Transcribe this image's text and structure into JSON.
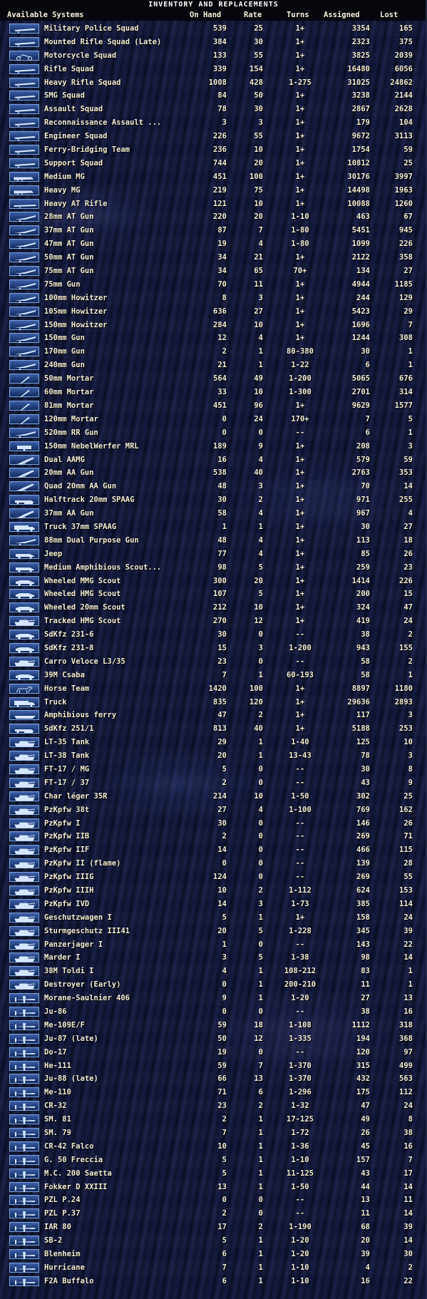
{
  "window": {
    "title": "INVENTORY AND REPLACEMENTS"
  },
  "header": {
    "systems": "Available Systems",
    "on_hand": "On Hand",
    "rate": "Rate",
    "turns": "Turns",
    "assigned": "Assigned",
    "lost": "Lost"
  },
  "colors": {
    "text": "#f3ecd4",
    "icon_fill": "#2b4a90",
    "icon_border": "#7ea2df",
    "background": "#0d1128"
  },
  "rows": [
    {
      "icon": "infantry-icon",
      "name": "Military Police Squad",
      "on_hand": "539",
      "rate": "25",
      "turns": "1+",
      "assigned": "3354",
      "lost": "165"
    },
    {
      "icon": "infantry-icon",
      "name": "Mounted Rifle Squad (Late)",
      "on_hand": "384",
      "rate": "30",
      "turns": "1+",
      "assigned": "2323",
      "lost": "375"
    },
    {
      "icon": "motorcycle-icon",
      "name": "Motorcycle Squad",
      "on_hand": "133",
      "rate": "55",
      "turns": "1+",
      "assigned": "3825",
      "lost": "2039"
    },
    {
      "icon": "infantry-icon",
      "name": "Rifle Squad",
      "on_hand": "339",
      "rate": "154",
      "turns": "1+",
      "assigned": "16480",
      "lost": "6056"
    },
    {
      "icon": "infantry-icon",
      "name": "Heavy Rifle Squad",
      "on_hand": "1008",
      "rate": "428",
      "turns": "1-275",
      "assigned": "31025",
      "lost": "24862"
    },
    {
      "icon": "infantry-icon",
      "name": "SMG Squad",
      "on_hand": "84",
      "rate": "50",
      "turns": "1+",
      "assigned": "3238",
      "lost": "2144"
    },
    {
      "icon": "infantry-icon",
      "name": "Assault Squad",
      "on_hand": "78",
      "rate": "30",
      "turns": "1+",
      "assigned": "2867",
      "lost": "2628"
    },
    {
      "icon": "infantry-icon",
      "name": "Reconnaissance Assault ...",
      "on_hand": "3",
      "rate": "3",
      "turns": "1+",
      "assigned": "179",
      "lost": "104"
    },
    {
      "icon": "infantry-icon",
      "name": "Engineer Squad",
      "on_hand": "226",
      "rate": "55",
      "turns": "1+",
      "assigned": "9672",
      "lost": "3113"
    },
    {
      "icon": "infantry-icon",
      "name": "Ferry-Bridging Team",
      "on_hand": "236",
      "rate": "10",
      "turns": "1+",
      "assigned": "1754",
      "lost": "59"
    },
    {
      "icon": "infantry-icon",
      "name": "Support Squad",
      "on_hand": "744",
      "rate": "20",
      "turns": "1+",
      "assigned": "10812",
      "lost": "25"
    },
    {
      "icon": "machinegun-icon",
      "name": "Medium MG",
      "on_hand": "451",
      "rate": "100",
      "turns": "1+",
      "assigned": "30176",
      "lost": "3997"
    },
    {
      "icon": "machinegun-icon",
      "name": "Heavy MG",
      "on_hand": "219",
      "rate": "75",
      "turns": "1+",
      "assigned": "14498",
      "lost": "1963"
    },
    {
      "icon": "rifle-icon",
      "name": "Heavy AT Rifle",
      "on_hand": "121",
      "rate": "10",
      "turns": "1+",
      "assigned": "10088",
      "lost": "1260"
    },
    {
      "icon": "gun-icon",
      "name": "28mm AT Gun",
      "on_hand": "220",
      "rate": "20",
      "turns": "1-10",
      "assigned": "463",
      "lost": "67"
    },
    {
      "icon": "gun-icon",
      "name": "37mm AT Gun",
      "on_hand": "87",
      "rate": "7",
      "turns": "1-80",
      "assigned": "5451",
      "lost": "945"
    },
    {
      "icon": "gun-icon",
      "name": "47mm AT Gun",
      "on_hand": "19",
      "rate": "4",
      "turns": "1-80",
      "assigned": "1099",
      "lost": "226"
    },
    {
      "icon": "gun-icon",
      "name": "50mm AT Gun",
      "on_hand": "34",
      "rate": "21",
      "turns": "1+",
      "assigned": "2122",
      "lost": "358"
    },
    {
      "icon": "gun-icon",
      "name": "75mm AT Gun",
      "on_hand": "34",
      "rate": "65",
      "turns": "70+",
      "assigned": "134",
      "lost": "27"
    },
    {
      "icon": "gun-icon",
      "name": "75mm Gun",
      "on_hand": "70",
      "rate": "11",
      "turns": "1+",
      "assigned": "4944",
      "lost": "1185"
    },
    {
      "icon": "gun-icon",
      "name": "100mm Howitzer",
      "on_hand": "8",
      "rate": "3",
      "turns": "1+",
      "assigned": "244",
      "lost": "129"
    },
    {
      "icon": "gun-icon",
      "name": "105mm Howitzer",
      "on_hand": "636",
      "rate": "27",
      "turns": "1+",
      "assigned": "5423",
      "lost": "29"
    },
    {
      "icon": "gun-icon",
      "name": "150mm Howitzer",
      "on_hand": "284",
      "rate": "10",
      "turns": "1+",
      "assigned": "1696",
      "lost": "7"
    },
    {
      "icon": "gun-icon",
      "name": "150mm Gun",
      "on_hand": "12",
      "rate": "4",
      "turns": "1+",
      "assigned": "1244",
      "lost": "308"
    },
    {
      "icon": "gun-icon",
      "name": "170mm Gun",
      "on_hand": "2",
      "rate": "1",
      "turns": "80-380",
      "assigned": "30",
      "lost": "1"
    },
    {
      "icon": "gun-icon",
      "name": "240mm Gun",
      "on_hand": "21",
      "rate": "1",
      "turns": "1-22",
      "assigned": "6",
      "lost": "1"
    },
    {
      "icon": "mortar-icon",
      "name": "50mm Mortar",
      "on_hand": "564",
      "rate": "49",
      "turns": "1-200",
      "assigned": "5065",
      "lost": "676"
    },
    {
      "icon": "mortar-icon",
      "name": "60mm Mortar",
      "on_hand": "33",
      "rate": "10",
      "turns": "1-300",
      "assigned": "2701",
      "lost": "314"
    },
    {
      "icon": "mortar-icon",
      "name": "81mm Mortar",
      "on_hand": "451",
      "rate": "96",
      "turns": "1+",
      "assigned": "9629",
      "lost": "1577"
    },
    {
      "icon": "mortar-icon",
      "name": "120mm Mortar",
      "on_hand": "0",
      "rate": "24",
      "turns": "170+",
      "assigned": "7",
      "lost": "5"
    },
    {
      "icon": "gun-icon",
      "name": "520mm RR Gun",
      "on_hand": "0",
      "rate": "0",
      "turns": "--",
      "assigned": "6",
      "lost": "1"
    },
    {
      "icon": "rocket-icon",
      "name": "150mm NebelWerfer MRL",
      "on_hand": "189",
      "rate": "9",
      "turns": "1+",
      "assigned": "208",
      "lost": "3"
    },
    {
      "icon": "aa-gun-icon",
      "name": "Dual AAMG",
      "on_hand": "16",
      "rate": "4",
      "turns": "1+",
      "assigned": "579",
      "lost": "59"
    },
    {
      "icon": "aa-gun-icon",
      "name": "20mm AA Gun",
      "on_hand": "538",
      "rate": "40",
      "turns": "1+",
      "assigned": "2763",
      "lost": "353"
    },
    {
      "icon": "aa-gun-icon",
      "name": "Quad 20mm AA Gun",
      "on_hand": "48",
      "rate": "3",
      "turns": "1+",
      "assigned": "70",
      "lost": "14"
    },
    {
      "icon": "halftrack-icon",
      "name": "Halftrack 20mm SPAAG",
      "on_hand": "30",
      "rate": "2",
      "turns": "1+",
      "assigned": "971",
      "lost": "255"
    },
    {
      "icon": "aa-gun-icon",
      "name": "37mm AA Gun",
      "on_hand": "58",
      "rate": "4",
      "turns": "1+",
      "assigned": "967",
      "lost": "4"
    },
    {
      "icon": "truck-icon",
      "name": "Truck 37mm SPAAG",
      "on_hand": "1",
      "rate": "1",
      "turns": "1+",
      "assigned": "30",
      "lost": "27"
    },
    {
      "icon": "gun-icon",
      "name": "88mm Dual Purpose Gun",
      "on_hand": "48",
      "rate": "4",
      "turns": "1+",
      "assigned": "113",
      "lost": "18"
    },
    {
      "icon": "car-icon",
      "name": "Jeep",
      "on_hand": "77",
      "rate": "4",
      "turns": "1+",
      "assigned": "85",
      "lost": "26"
    },
    {
      "icon": "car-icon",
      "name": "Medium Amphibious Scout...",
      "on_hand": "98",
      "rate": "5",
      "turns": "1+",
      "assigned": "259",
      "lost": "23"
    },
    {
      "icon": "armored-car-icon",
      "name": "Wheeled MMG Scout",
      "on_hand": "300",
      "rate": "20",
      "turns": "1+",
      "assigned": "1414",
      "lost": "226"
    },
    {
      "icon": "armored-car-icon",
      "name": "Wheeled HMG Scout",
      "on_hand": "107",
      "rate": "5",
      "turns": "1+",
      "assigned": "200",
      "lost": "15"
    },
    {
      "icon": "armored-car-icon",
      "name": "Wheeled 20mm Scout",
      "on_hand": "212",
      "rate": "10",
      "turns": "1+",
      "assigned": "324",
      "lost": "47"
    },
    {
      "icon": "tank-icon",
      "name": "Tracked HMG Scout",
      "on_hand": "270",
      "rate": "12",
      "turns": "1+",
      "assigned": "419",
      "lost": "24"
    },
    {
      "icon": "armored-car-icon",
      "name": "SdKfz 231-6",
      "on_hand": "30",
      "rate": "0",
      "turns": "--",
      "assigned": "38",
      "lost": "2"
    },
    {
      "icon": "armored-car-icon",
      "name": "SdKfz 231-8",
      "on_hand": "15",
      "rate": "3",
      "turns": "1-200",
      "assigned": "943",
      "lost": "155"
    },
    {
      "icon": "tank-icon",
      "name": "Carro Veloce L3/35",
      "on_hand": "23",
      "rate": "0",
      "turns": "--",
      "assigned": "58",
      "lost": "2"
    },
    {
      "icon": "armored-car-icon",
      "name": "39M Csaba",
      "on_hand": "7",
      "rate": "1",
      "turns": "60-193",
      "assigned": "58",
      "lost": "1"
    },
    {
      "icon": "horse-icon",
      "name": "Horse Team",
      "on_hand": "1420",
      "rate": "100",
      "turns": "1+",
      "assigned": "8897",
      "lost": "1180"
    },
    {
      "icon": "truck-icon",
      "name": "Truck",
      "on_hand": "835",
      "rate": "120",
      "turns": "1+",
      "assigned": "29636",
      "lost": "2893"
    },
    {
      "icon": "boat-icon",
      "name": "Amphibious ferry",
      "on_hand": "47",
      "rate": "2",
      "turns": "1+",
      "assigned": "117",
      "lost": "3"
    },
    {
      "icon": "halftrack-icon",
      "name": "SdKfz 251/1",
      "on_hand": "813",
      "rate": "40",
      "turns": "1+",
      "assigned": "5188",
      "lost": "253"
    },
    {
      "icon": "tank-icon",
      "name": "LT-35 Tank",
      "on_hand": "29",
      "rate": "1",
      "turns": "1-40",
      "assigned": "125",
      "lost": "10"
    },
    {
      "icon": "tank-icon",
      "name": "LT-38 Tank",
      "on_hand": "20",
      "rate": "1",
      "turns": "13-43",
      "assigned": "78",
      "lost": "3"
    },
    {
      "icon": "tank-icon",
      "name": "FT-17 / MG",
      "on_hand": "5",
      "rate": "0",
      "turns": "--",
      "assigned": "30",
      "lost": "8"
    },
    {
      "icon": "tank-icon",
      "name": "FT-17 / 37",
      "on_hand": "2",
      "rate": "0",
      "turns": "--",
      "assigned": "43",
      "lost": "9"
    },
    {
      "icon": "tank-icon",
      "name": "Char léger 35R",
      "on_hand": "214",
      "rate": "10",
      "turns": "1-50",
      "assigned": "302",
      "lost": "25"
    },
    {
      "icon": "tank-icon",
      "name": "PzKpfw 38t",
      "on_hand": "27",
      "rate": "4",
      "turns": "1-100",
      "assigned": "769",
      "lost": "162"
    },
    {
      "icon": "tank-icon",
      "name": "PzKpfw I",
      "on_hand": "30",
      "rate": "0",
      "turns": "--",
      "assigned": "146",
      "lost": "26"
    },
    {
      "icon": "tank-icon",
      "name": "PzKpfw IIB",
      "on_hand": "2",
      "rate": "0",
      "turns": "--",
      "assigned": "269",
      "lost": "71"
    },
    {
      "icon": "tank-icon",
      "name": "PzKpfw IIF",
      "on_hand": "14",
      "rate": "0",
      "turns": "--",
      "assigned": "466",
      "lost": "115"
    },
    {
      "icon": "tank-icon",
      "name": "PzKpfw II (flame)",
      "on_hand": "0",
      "rate": "0",
      "turns": "--",
      "assigned": "139",
      "lost": "28"
    },
    {
      "icon": "tank-icon",
      "name": "PzKpfw IIIG",
      "on_hand": "124",
      "rate": "0",
      "turns": "--",
      "assigned": "269",
      "lost": "55"
    },
    {
      "icon": "tank-icon",
      "name": "PzKpfw IIIH",
      "on_hand": "10",
      "rate": "2",
      "turns": "1-112",
      "assigned": "624",
      "lost": "153"
    },
    {
      "icon": "tank-icon",
      "name": "PzKpfw IVD",
      "on_hand": "14",
      "rate": "3",
      "turns": "1-73",
      "assigned": "385",
      "lost": "114"
    },
    {
      "icon": "tank-icon",
      "name": "Geschutzwagen I",
      "on_hand": "5",
      "rate": "1",
      "turns": "1+",
      "assigned": "158",
      "lost": "24"
    },
    {
      "icon": "tank-icon",
      "name": "Sturmgeschutz III41",
      "on_hand": "20",
      "rate": "5",
      "turns": "1-228",
      "assigned": "345",
      "lost": "39"
    },
    {
      "icon": "tank-icon",
      "name": "Panzerjager I",
      "on_hand": "1",
      "rate": "0",
      "turns": "--",
      "assigned": "143",
      "lost": "22"
    },
    {
      "icon": "tank-icon",
      "name": "Marder I",
      "on_hand": "3",
      "rate": "5",
      "turns": "1-38",
      "assigned": "98",
      "lost": "14"
    },
    {
      "icon": "tank-icon",
      "name": "38M Toldi I",
      "on_hand": "4",
      "rate": "1",
      "turns": "108-212",
      "assigned": "83",
      "lost": "1"
    },
    {
      "icon": "tank-icon",
      "name": "Destroyer (Early)",
      "on_hand": "0",
      "rate": "1",
      "turns": "200-210",
      "assigned": "11",
      "lost": "1"
    },
    {
      "icon": "aircraft-icon",
      "name": "Morane-Saulnier 406",
      "on_hand": "9",
      "rate": "1",
      "turns": "1-20",
      "assigned": "27",
      "lost": "13"
    },
    {
      "icon": "aircraft-icon",
      "name": "Ju-86",
      "on_hand": "0",
      "rate": "0",
      "turns": "--",
      "assigned": "38",
      "lost": "16"
    },
    {
      "icon": "aircraft-icon",
      "name": "Me-109E/F",
      "on_hand": "59",
      "rate": "18",
      "turns": "1-108",
      "assigned": "1112",
      "lost": "318"
    },
    {
      "icon": "aircraft-icon",
      "name": "Ju-87 (late)",
      "on_hand": "50",
      "rate": "12",
      "turns": "1-335",
      "assigned": "194",
      "lost": "368"
    },
    {
      "icon": "aircraft-icon",
      "name": "Do-17",
      "on_hand": "19",
      "rate": "0",
      "turns": "--",
      "assigned": "120",
      "lost": "97"
    },
    {
      "icon": "aircraft-icon",
      "name": "He-111",
      "on_hand": "59",
      "rate": "7",
      "turns": "1-370",
      "assigned": "315",
      "lost": "499"
    },
    {
      "icon": "aircraft-icon",
      "name": "Ju-88 (late)",
      "on_hand": "66",
      "rate": "13",
      "turns": "1-370",
      "assigned": "432",
      "lost": "563"
    },
    {
      "icon": "aircraft-icon",
      "name": "Me-110",
      "on_hand": "71",
      "rate": "6",
      "turns": "1-296",
      "assigned": "175",
      "lost": "112"
    },
    {
      "icon": "aircraft-icon",
      "name": "CR-32",
      "on_hand": "23",
      "rate": "2",
      "turns": "1-32",
      "assigned": "47",
      "lost": "24"
    },
    {
      "icon": "aircraft-icon",
      "name": "SM. 81",
      "on_hand": "2",
      "rate": "1",
      "turns": "17-125",
      "assigned": "49",
      "lost": "8"
    },
    {
      "icon": "aircraft-icon",
      "name": "SM. 79",
      "on_hand": "7",
      "rate": "1",
      "turns": "1-72",
      "assigned": "26",
      "lost": "38"
    },
    {
      "icon": "aircraft-icon",
      "name": "CR-42 Falco",
      "on_hand": "10",
      "rate": "1",
      "turns": "1-36",
      "assigned": "45",
      "lost": "16"
    },
    {
      "icon": "aircraft-icon",
      "name": "G. 50 Freccia",
      "on_hand": "5",
      "rate": "1",
      "turns": "1-10",
      "assigned": "157",
      "lost": "7"
    },
    {
      "icon": "aircraft-icon",
      "name": "M.C. 200 Saetta",
      "on_hand": "5",
      "rate": "1",
      "turns": "11-125",
      "assigned": "43",
      "lost": "17"
    },
    {
      "icon": "aircraft-icon",
      "name": "Fokker D XXIII",
      "on_hand": "13",
      "rate": "1",
      "turns": "1-50",
      "assigned": "44",
      "lost": "14"
    },
    {
      "icon": "aircraft-icon",
      "name": "PZL P.24",
      "on_hand": "0",
      "rate": "0",
      "turns": "--",
      "assigned": "13",
      "lost": "11"
    },
    {
      "icon": "aircraft-icon",
      "name": "PZL P.37",
      "on_hand": "2",
      "rate": "0",
      "turns": "--",
      "assigned": "11",
      "lost": "14"
    },
    {
      "icon": "aircraft-icon",
      "name": "IAR 80",
      "on_hand": "17",
      "rate": "2",
      "turns": "1-190",
      "assigned": "68",
      "lost": "39"
    },
    {
      "icon": "aircraft-icon",
      "name": "SB-2",
      "on_hand": "5",
      "rate": "1",
      "turns": "1-20",
      "assigned": "20",
      "lost": "14"
    },
    {
      "icon": "aircraft-icon",
      "name": "Blenheim",
      "on_hand": "6",
      "rate": "1",
      "turns": "1-20",
      "assigned": "39",
      "lost": "30"
    },
    {
      "icon": "aircraft-icon",
      "name": "Hurricane",
      "on_hand": "7",
      "rate": "1",
      "turns": "1-10",
      "assigned": "4",
      "lost": "2"
    },
    {
      "icon": "aircraft-icon",
      "name": "F2A Buffalo",
      "on_hand": "6",
      "rate": "1",
      "turns": "1-10",
      "assigned": "16",
      "lost": "22"
    }
  ]
}
